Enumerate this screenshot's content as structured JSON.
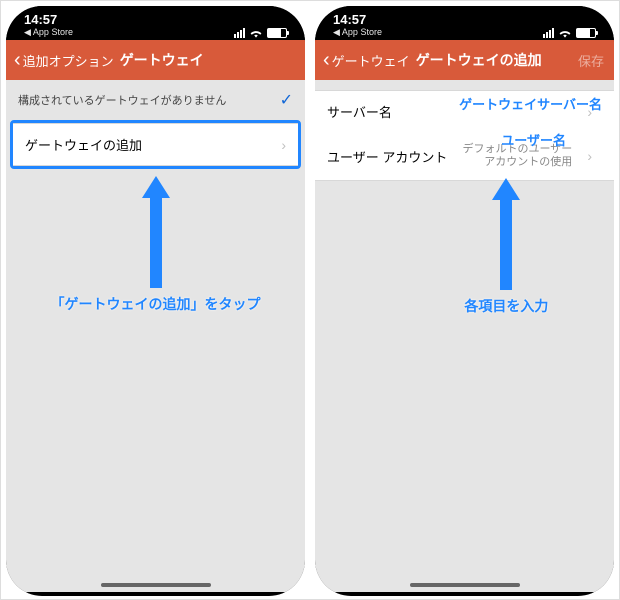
{
  "status": {
    "time": "14:57",
    "back_app": "◀ App Store"
  },
  "left": {
    "nav_back": "追加オプション",
    "nav_title": "ゲートウェイ",
    "note": "構成されているゲートウェイがありません",
    "add_row": "ゲートウェイの追加",
    "callout": "「ゲートウェイの追加」をタップ"
  },
  "right": {
    "nav_back": "ゲートウェイ",
    "nav_title": "ゲートウェイの追加",
    "nav_save": "保存",
    "row1_label": "サーバー名",
    "row2_label": "ユーザー アカウント",
    "row2_value_l1": "デフォルトのユーザー",
    "row2_value_l2": "アカウントの使用",
    "overlay_server": "ゲートウェイサーバー名",
    "overlay_user": "ユーザー名",
    "callout": "各項目を入力"
  }
}
